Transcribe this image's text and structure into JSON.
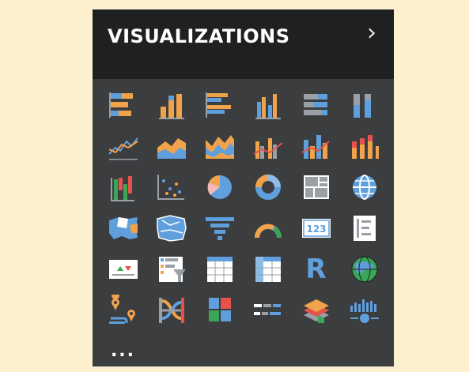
{
  "pane": {
    "title": "VISUALIZATIONS",
    "chevron": "›"
  },
  "icons": [
    [
      "stacked-bar-icon",
      "stacked-column-icon",
      "clustered-bar-icon",
      "clustered-column-icon",
      "100-stacked-bar-icon",
      "100-stacked-column-icon"
    ],
    [
      "line-chart-icon",
      "area-chart-icon",
      "stacked-area-icon",
      "line-clustered-column-icon",
      "line-stacked-column-icon",
      "ribbon-chart-icon"
    ],
    [
      "waterfall-icon",
      "scatter-icon",
      "pie-icon",
      "donut-icon",
      "treemap-icon",
      "globe-map-icon"
    ],
    [
      "filled-map-icon",
      "shape-map-icon",
      "funnel-icon",
      "gauge-icon",
      "card-icon",
      "multi-row-card-icon"
    ],
    [
      "kpi-icon",
      "slicer-icon",
      "table-icon",
      "matrix-icon",
      "r-visual-icon",
      "arcgis-map-icon"
    ],
    [
      "route-map-icon",
      "sankey-icon",
      "tiles-icon",
      "bullet-chart-icon",
      "layers-icon",
      "timeline-icon"
    ],
    [
      "more-visuals-icon"
    ]
  ],
  "labels": {
    "card_number": "123",
    "r_letter": "R",
    "more": "..."
  },
  "colors": {
    "orange": "#f0a34a",
    "blue": "#5f9fdc",
    "gray": "#9aa0a6",
    "red": "#e5534b",
    "green": "#3aa657"
  }
}
